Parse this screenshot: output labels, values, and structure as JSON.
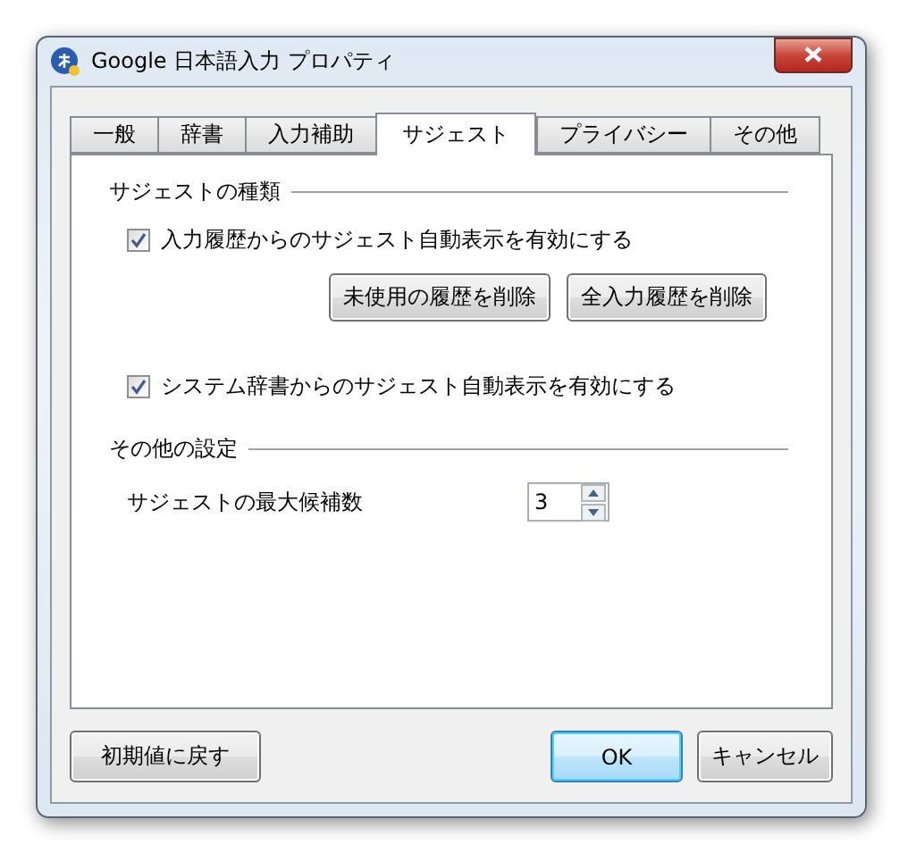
{
  "window": {
    "title": "Google 日本語入力 プロパティ"
  },
  "tabs": [
    {
      "label": "一般",
      "selected": false
    },
    {
      "label": "辞書",
      "selected": false
    },
    {
      "label": "入力補助",
      "selected": false
    },
    {
      "label": "サジェスト",
      "selected": true
    },
    {
      "label": "プライバシー",
      "selected": false
    },
    {
      "label": "その他",
      "selected": false
    }
  ],
  "sections": [
    {
      "title": "サジェストの種類",
      "items": [
        {
          "kind": "checkbox",
          "label": "入力履歴からのサジェスト自動表示を有効にする",
          "checked": true
        },
        {
          "kind": "buttons",
          "buttons": [
            "未使用の履歴を削除",
            "全入力履歴を削除"
          ]
        },
        {
          "kind": "checkbox",
          "label": "システム辞書からのサジェスト自動表示を有効にする",
          "checked": true
        }
      ]
    },
    {
      "title": "その他の設定",
      "items": [
        {
          "kind": "spinner",
          "label": "サジェストの最大候補数",
          "value": "3"
        }
      ]
    }
  ],
  "footer": {
    "left_buttons": [
      {
        "label": "初期値に戻す",
        "default": false
      }
    ],
    "right_buttons": [
      {
        "label": "OK",
        "default": true
      },
      {
        "label": "キャンセル",
        "default": false
      }
    ]
  }
}
